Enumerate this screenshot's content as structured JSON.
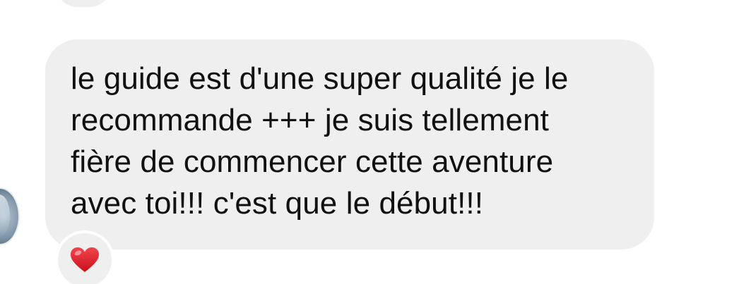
{
  "message": {
    "text": "le guide est d'une super qualité je le\nrecommande +++ je suis tellement\nfière de commencer cette aventure\navec toi!!! c'est que le début!!!",
    "reaction": "heart-icon"
  },
  "colors": {
    "bubble": "#efefef",
    "text": "#111111",
    "heart": "#e8242f"
  }
}
